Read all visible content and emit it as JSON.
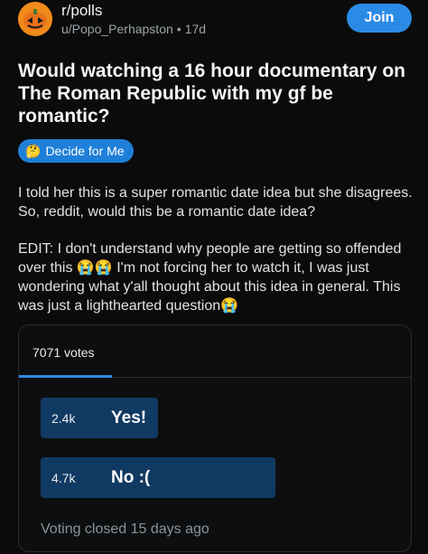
{
  "header": {
    "subreddit": "r/polls",
    "author": "u/Popo_Perhapston",
    "time_ago": "17d",
    "separator": "•",
    "join_label": "Join"
  },
  "post": {
    "title": "Would watching a 16 hour documentary on The Roman Republic with my gf be romantic?",
    "flair": {
      "emoji": "🤔",
      "label": "Decide for Me",
      "color": "#1f7fd8"
    },
    "paragraph1": "I told her this is a super romantic date idea but she disagrees. So, reddit, would this be a romantic date idea?",
    "paragraph2": "EDIT: I don't understand why people are getting so offended over this 😭😭 I'm not forcing her to watch it, I was just wondering what y'all thought about this idea in general. This was just a lighthearted question😭"
  },
  "poll": {
    "total_votes": "7071 votes",
    "options": [
      {
        "count": "2.4k",
        "label": "Yes!",
        "share": 0.34
      },
      {
        "count": "4.7k",
        "label": "No :(",
        "share": 0.66
      }
    ],
    "status": "Voting closed 15 days ago"
  },
  "colors": {
    "background": "#0b0b0b",
    "accent": "#2b8ae6",
    "poll_bar": "#113a63",
    "muted_text": "#9aa3a8"
  }
}
